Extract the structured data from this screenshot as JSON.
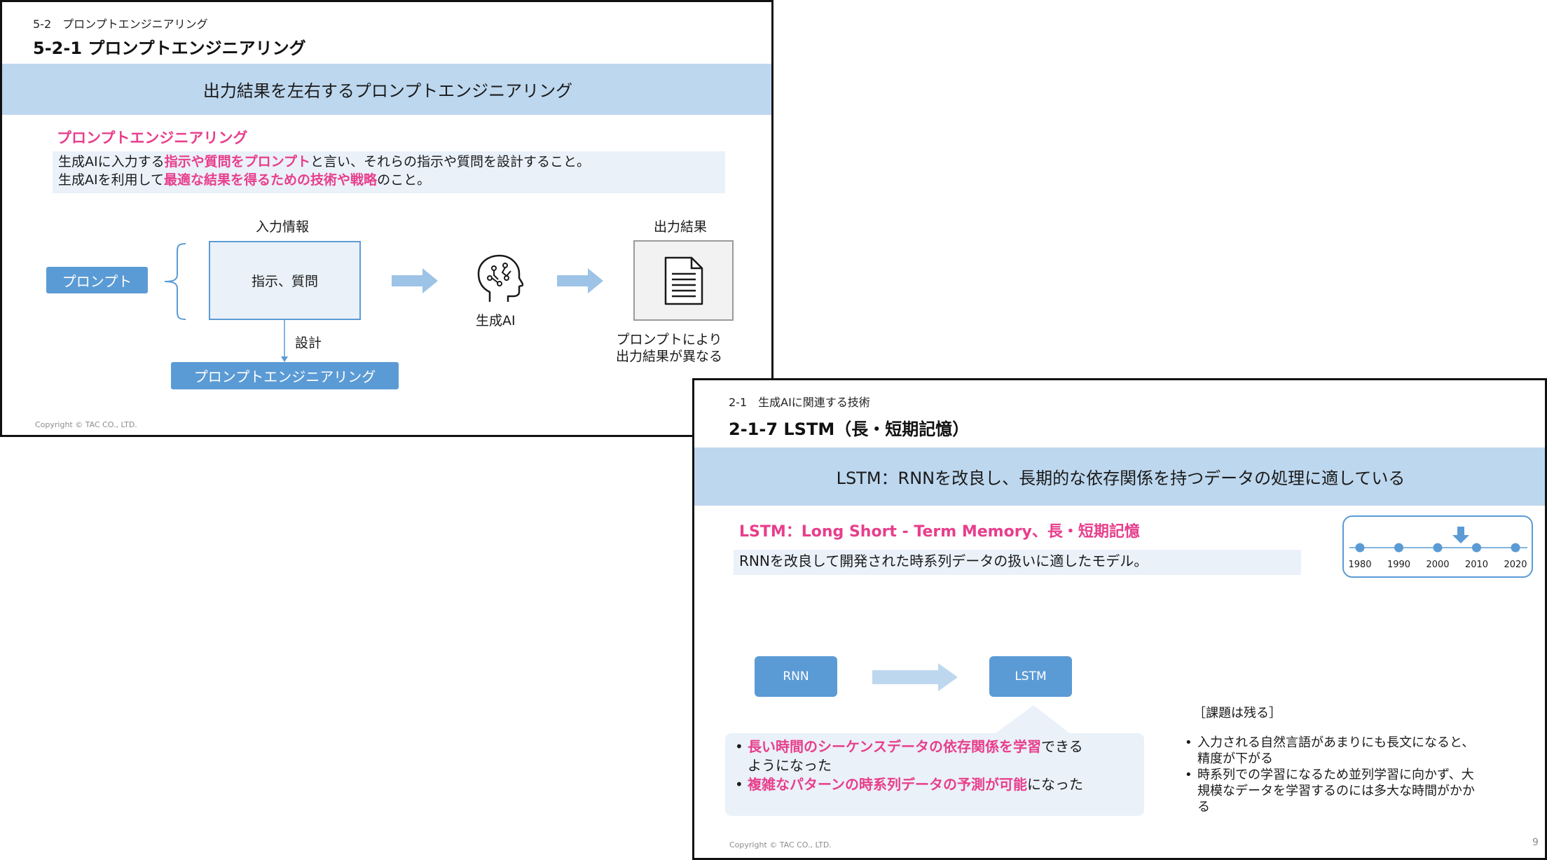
{
  "slide1": {
    "section": "5-2　プロンプトエンジニアリング",
    "title": "5-2-1 プロンプトエンジニアリング",
    "banner": "出力結果を左右するプロンプトエンジニアリング",
    "heading": "プロンプトエンジニアリング",
    "def_line1": {
      "pre": "生成AIに入力する",
      "em": "指示や質問をプロンプト",
      "post": "と言い、それらの指示や質問を設計すること。"
    },
    "def_line2": {
      "pre": "生成AIを利用して",
      "em": "最適な結果を得るための技術や戦略",
      "post": "のこと。"
    },
    "diagram": {
      "input_label": "入力情報",
      "prompt_button": "プロンプト",
      "input_box": "指示、質問",
      "design_label": "設計",
      "engineering_button": "プロンプトエンジニアリング",
      "ai_label": "生成AI",
      "output_label": "出力結果",
      "output_note_line1": "プロンプトにより",
      "output_note_line2": "出力結果が異なる",
      "ai_icon": "brain-head-icon",
      "doc_icon": "document-icon"
    },
    "copyright": "Copyright © TAC CO., LTD."
  },
  "slide2": {
    "section": "2-1　生成AIに関連する技術",
    "title": "2-1-7 LSTM（長・短期記憶）",
    "banner": "LSTM：RNNを改良し、長期的な依存関係を持つデータの処理に適している",
    "heading": "LSTM：Long Short - Term Memory、長・短期記憶",
    "definition": "RNNを改良して開発された時系列データの扱いに適したモデル。",
    "timeline": {
      "years": [
        "1980",
        "1990",
        "2000",
        "2010",
        "2020"
      ],
      "marker_icon": "down-arrow-icon"
    },
    "rnn_box": "RNN",
    "lstm_box": "LSTM",
    "achievements": [
      {
        "em": "長い時間のシーケンスデータの依存関係を学習",
        "post": "できる",
        "post2": "ようになった"
      },
      {
        "em": "複雑なパターンの時系列データの予測が可能",
        "post": "になった"
      }
    ],
    "issues_title": "［課題は残る］",
    "issues": [
      {
        "line1": "入力される自然言語があまりにも長文になると、",
        "line2": "精度が下がる"
      },
      {
        "line1": "時系列での学習になるため並列学習に向かず、大",
        "line2": "規模なデータを学習するのには多大な時間がかか",
        "line3": "る"
      }
    ],
    "copyright": "Copyright © TAC CO., LTD.",
    "page_number": "9",
    "colors": {
      "accent_blue": "#5b9bd5",
      "banner": "#bdd7ee",
      "pink": "#e83e8c"
    }
  }
}
